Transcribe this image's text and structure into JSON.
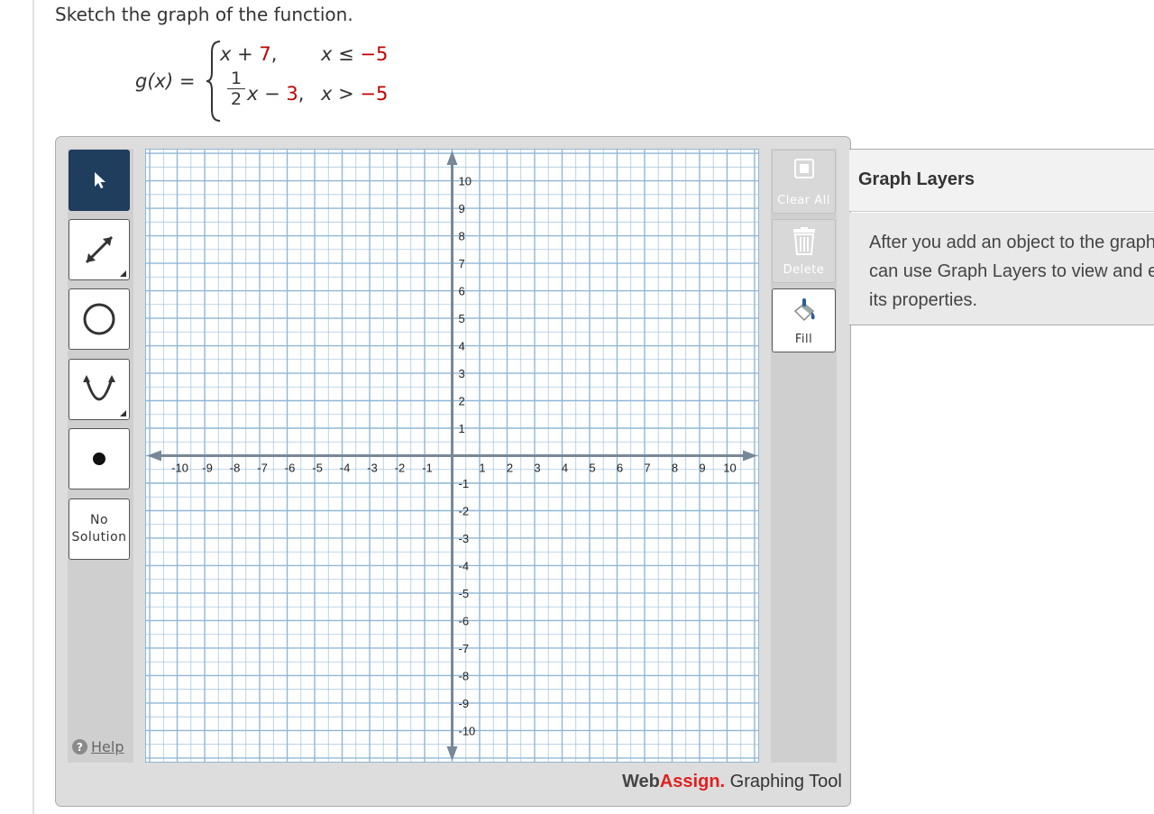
{
  "prompt": "Sketch the graph of the function.",
  "function": {
    "name": "g(x)",
    "equals": "=",
    "piece1": {
      "expr_x": "x",
      "expr_op": "+",
      "expr_const": "7",
      "comma": ",",
      "cond_var": "x",
      "cond_op": "≤",
      "cond_val": "−5"
    },
    "piece2": {
      "frac_num": "1",
      "frac_den": "2",
      "expr_x": "x",
      "expr_op": "−",
      "expr_const": "3",
      "comma": ",",
      "cond_var": "x",
      "cond_op": ">",
      "cond_val": "−5"
    }
  },
  "tools": {
    "pointer": {
      "icon": "pointer-arrow-icon",
      "active": true
    },
    "line": {
      "icon": "line-segment-icon"
    },
    "circle": {
      "icon": "circle-icon"
    },
    "parabola": {
      "icon": "parabola-icon"
    },
    "point": {
      "icon": "point-icon"
    },
    "no_solution": {
      "line1": "No",
      "line2": "Solution"
    },
    "help": {
      "label": "Help",
      "icon_glyph": "?"
    }
  },
  "actions": {
    "clear_all": {
      "label": "Clear All",
      "enabled": false
    },
    "delete": {
      "label": "Delete",
      "enabled": false
    },
    "fill": {
      "label": "Fill",
      "enabled": true
    }
  },
  "graph": {
    "x_range": [
      -10,
      10
    ],
    "y_range": [
      -10,
      10
    ],
    "grid_step": 0.5,
    "label_step": 1,
    "grid_color": "#8fb7d6",
    "axis_color": "#778899"
  },
  "brand": {
    "part1": "Web",
    "part2": "Assign.",
    "part3": " Graphing Tool",
    "accent": "#e0201f"
  },
  "layers": {
    "title": "Graph Layers",
    "description": "After you add an object to the graph you can use Graph Layers to view and edit its properties."
  }
}
